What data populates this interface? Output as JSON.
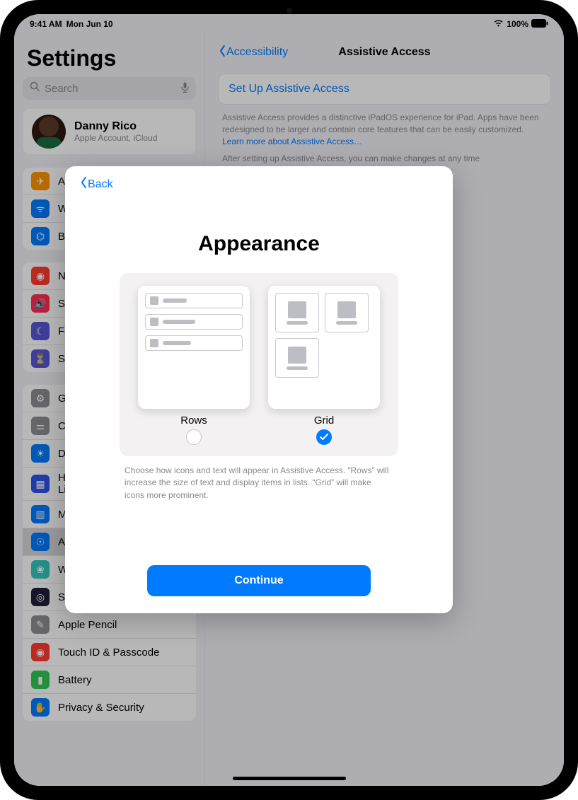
{
  "status": {
    "time": "9:41 AM",
    "date": "Mon Jun 10",
    "battery": "100%"
  },
  "sidebar": {
    "title": "Settings",
    "search_placeholder": "Search",
    "profile": {
      "name": "Danny Rico",
      "sub": "Apple Account, iCloud"
    },
    "group1": [
      {
        "label": "Airplane Mode",
        "color": "#ff9500"
      },
      {
        "label": "Wi-Fi",
        "color": "#007aff"
      },
      {
        "label": "Bluetooth",
        "color": "#007aff"
      }
    ],
    "group2": [
      {
        "label": "Notifications",
        "color": "#ff3b30"
      },
      {
        "label": "Sounds",
        "color": "#ff2d55"
      },
      {
        "label": "Focus",
        "color": "#5856d6"
      },
      {
        "label": "Screen Time",
        "color": "#5856d6"
      }
    ],
    "group3": [
      {
        "label": "General",
        "color": "#8e8e93"
      },
      {
        "label": "Control Center",
        "color": "#8e8e93"
      },
      {
        "label": "Display & Brightness",
        "color": "#007aff"
      },
      {
        "label": "Home Screen & App Library",
        "color": "#2f54eb"
      },
      {
        "label": "Multitasking & Gestures",
        "color": "#007aff"
      },
      {
        "label": "Accessibility",
        "color": "#007aff",
        "selected": true
      },
      {
        "label": "Wallpaper",
        "color": "#34c7c0"
      },
      {
        "label": "Siri & Search",
        "color": "#1f1f3d"
      },
      {
        "label": "Apple Pencil",
        "color": "#8e8e93"
      },
      {
        "label": "Touch ID & Passcode",
        "color": "#ff3b30"
      },
      {
        "label": "Battery",
        "color": "#34c759"
      },
      {
        "label": "Privacy & Security",
        "color": "#007aff"
      }
    ]
  },
  "detail": {
    "back_label": "Accessibility",
    "title": "Assistive Access",
    "setup_link": "Set Up Assistive Access",
    "desc_a": "Assistive Access provides a distinctive iPadOS experience for iPad. Apps have been redesigned to be larger and contain core features that can be easily customized. ",
    "desc_link": "Learn more about Assistive Access…",
    "desc_b": "After setting up Assistive Access, you can make changes at any time"
  },
  "modal": {
    "back": "Back",
    "title": "Appearance",
    "option_rows": "Rows",
    "option_grid": "Grid",
    "selected": "grid",
    "helper": "Choose how icons and text will appear in Assistive Access. “Rows” will increase the size of text and display items in lists. “Grid” will make icons more prominent.",
    "continue": "Continue"
  }
}
